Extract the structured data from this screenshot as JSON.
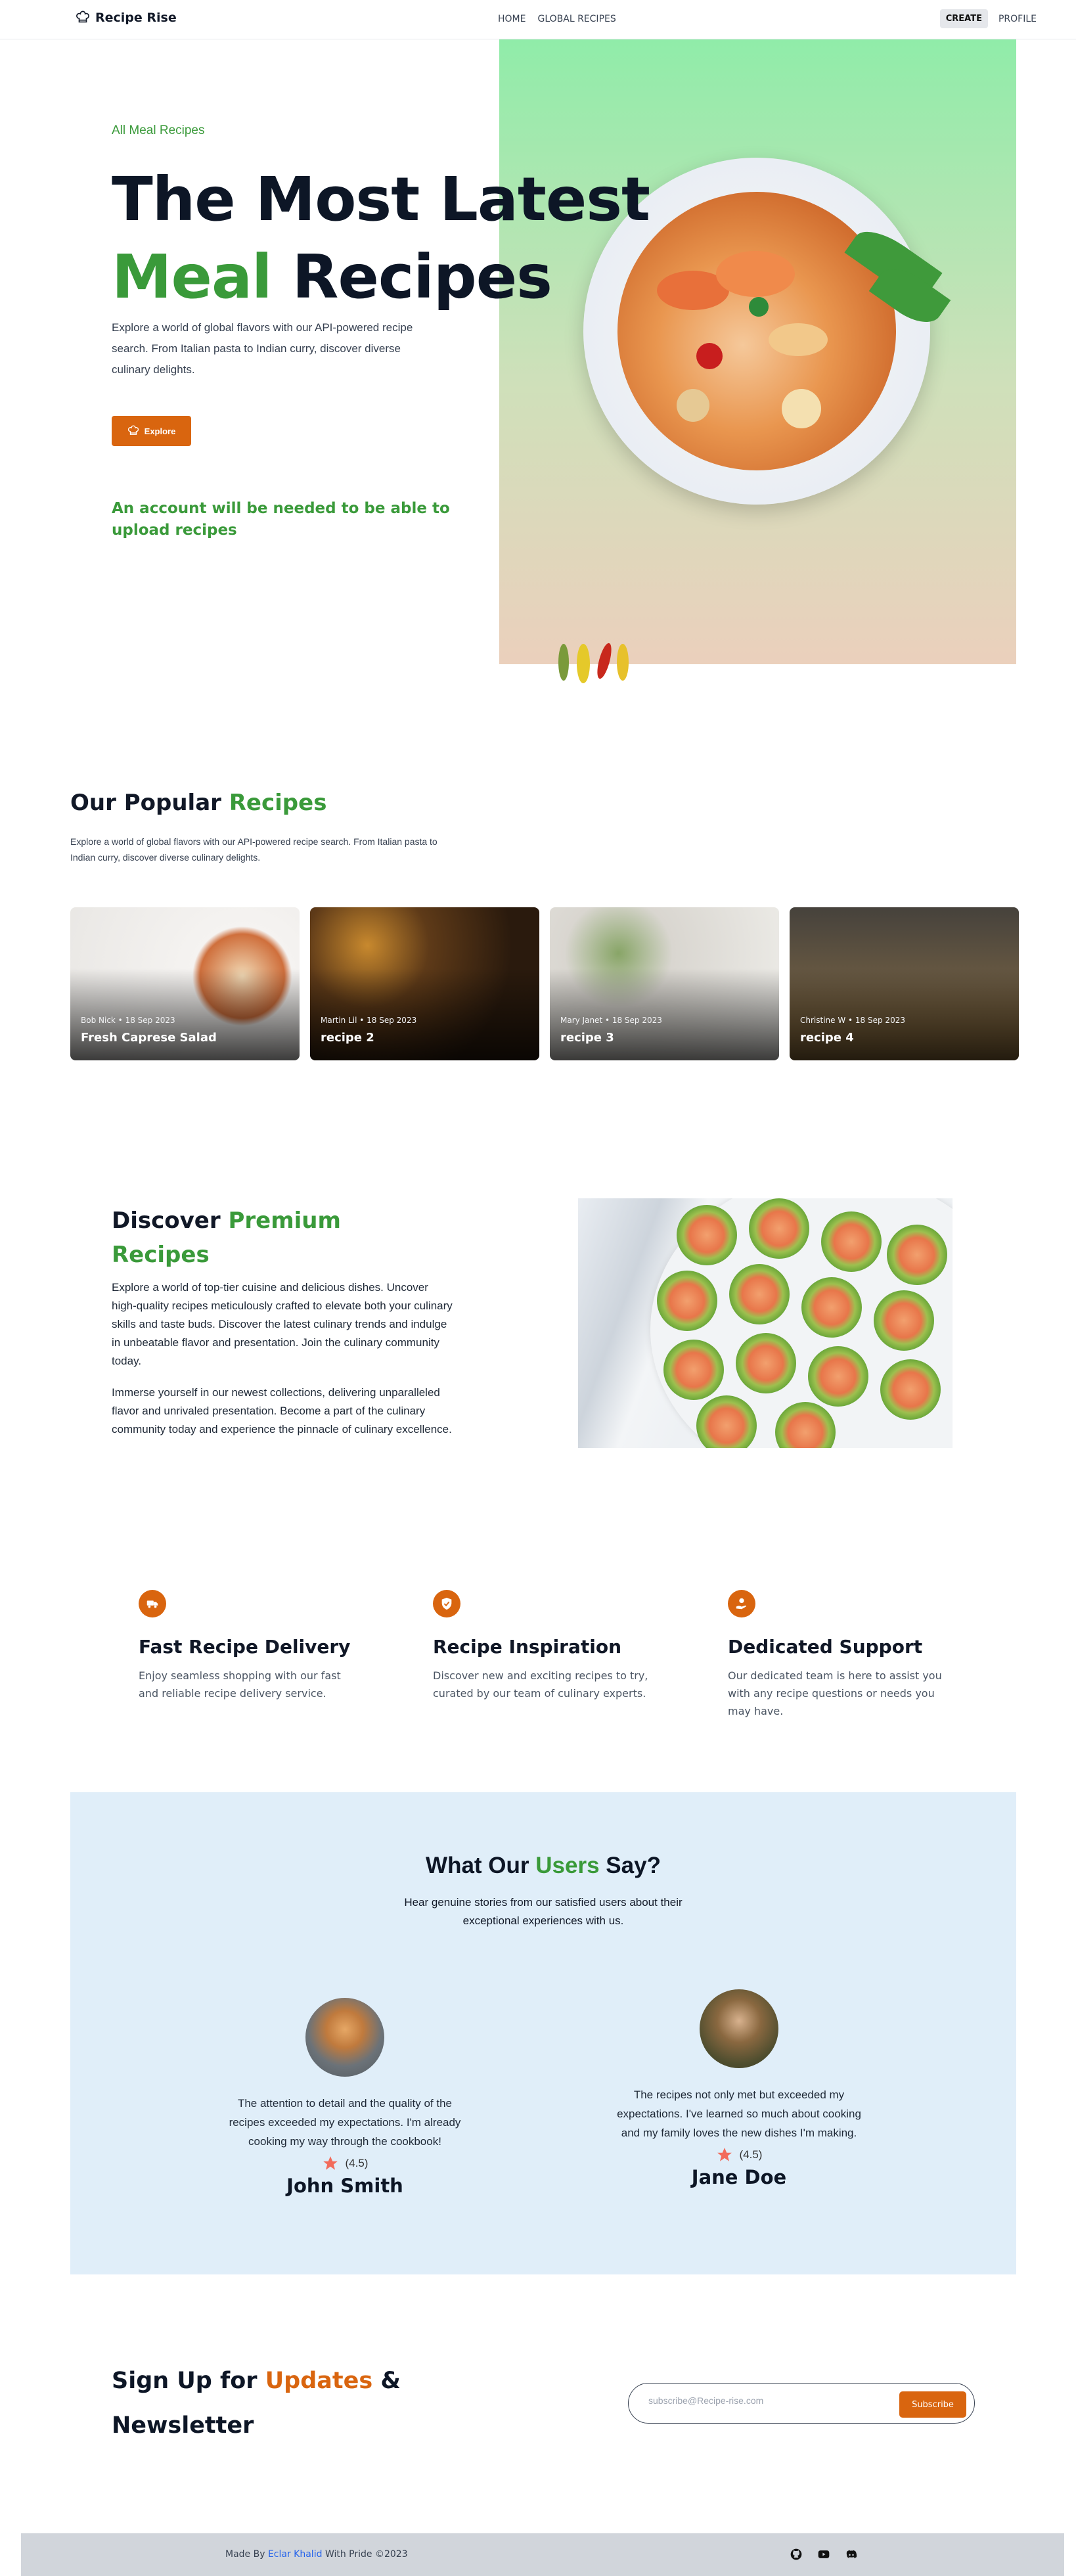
{
  "nav": {
    "brand": "Recipe Rise",
    "links": [
      "HOME",
      "GLOBAL RECIPES"
    ],
    "create": "CREATE",
    "profile": "PROFILE"
  },
  "hero": {
    "caption": "All Meal Recipes",
    "title_line1": "The Most Latest",
    "title_word_green": "Meal",
    "title_word_dark": "Recipes",
    "description": "Explore a world of global flavors with our API-powered recipe search. From Italian pasta to Indian curry, discover diverse culinary delights.",
    "button": "Explore",
    "note": "An account will be needed to be able to upload recipes"
  },
  "popular": {
    "title_dark": "Our Popular",
    "title_green": "Recipes",
    "description": "Explore a world of global flavors with our API-powered recipe search. From Italian pasta to Indian curry, discover diverse culinary delights.",
    "cards": [
      {
        "meta": "Bob Nick • 18 Sep 2023",
        "title": "Fresh Caprese Salad"
      },
      {
        "meta": "Martin Lil • 18 Sep 2023",
        "title": "recipe 2"
      },
      {
        "meta": "Mary Janet • 18 Sep 2023",
        "title": "recipe 3"
      },
      {
        "meta": "Christine W • 18 Sep 2023",
        "title": "recipe 4"
      }
    ]
  },
  "premium": {
    "title_dark": "Discover",
    "title_green": "Premium Recipes",
    "para1": "Explore a world of top-tier cuisine and delicious dishes. Uncover high-quality recipes meticulously crafted to elevate both your culinary skills and taste buds. Discover the latest culinary trends and indulge in unbeatable flavor and presentation. Join the culinary community today.",
    "para2": "Immerse yourself in our newest collections, delivering unparalleled flavor and unrivaled presentation. Become a part of the culinary community today and experience the pinnacle of culinary excellence."
  },
  "features": [
    {
      "icon": "delivery-truck-icon",
      "title": "Fast Recipe Delivery",
      "desc": "Enjoy seamless shopping with our fast and reliable recipe delivery service."
    },
    {
      "icon": "shield-check-icon",
      "title": "Recipe Inspiration",
      "desc": "Discover new and exciting recipes to try, curated by our team of culinary experts."
    },
    {
      "icon": "support-hand-icon",
      "title": "Dedicated Support",
      "desc": "Our dedicated team is here to assist you with any recipe questions or needs you may have."
    }
  ],
  "testimonials": {
    "title_a": "What Our",
    "title_green": "Users",
    "title_b": "Say?",
    "subtitle": "Hear genuine stories from our satisfied users about their exceptional experiences with us.",
    "items": [
      {
        "quote": "The attention to detail and the quality of the recipes exceeded my expectations. I'm already cooking my way through the cookbook!",
        "rating": "(4.5)",
        "name": "John Smith"
      },
      {
        "quote": "The recipes not only met but exceeded my expectations. I've learned so much about cooking and my family loves the new dishes I'm making.",
        "rating": "(4.5)",
        "name": "Jane Doe"
      }
    ]
  },
  "signup": {
    "title_a": "Sign Up for",
    "title_orange": "Updates",
    "title_b": "& Newsletter",
    "placeholder": "subscribe@Recipe-rise.com",
    "button": "Subscribe"
  },
  "footer": {
    "made_by": "Made By",
    "author": "Eclar Khalid",
    "suffix": "With Pride ©2023",
    "icons": [
      "github-icon",
      "youtube-icon",
      "discord-icon"
    ]
  },
  "colors": {
    "accent_green": "#3a9a3a",
    "accent_orange": "#d9650f",
    "testimonial_bg": "#e0eef9",
    "footer_bg": "#d1d5db"
  }
}
